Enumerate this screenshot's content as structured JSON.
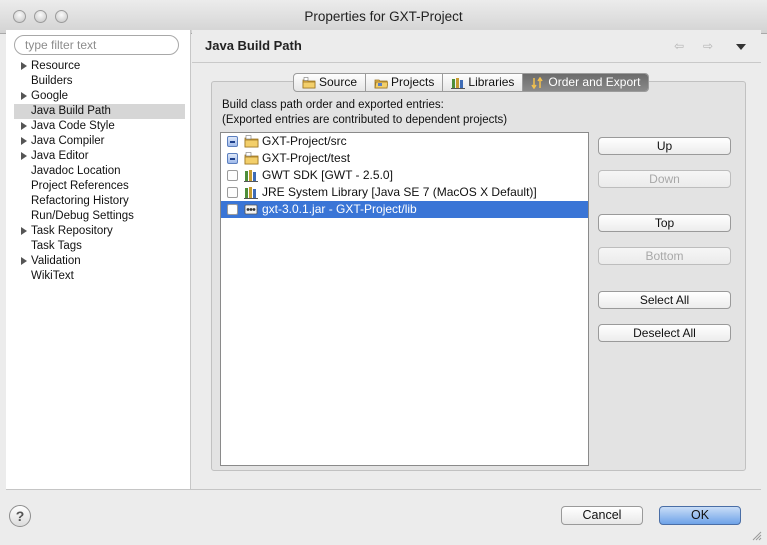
{
  "window": {
    "title": "Properties for GXT-Project"
  },
  "filter": {
    "placeholder": "type filter text"
  },
  "sidebar": {
    "items": [
      {
        "label": "Resource",
        "expandable": true
      },
      {
        "label": "Builders",
        "expandable": false
      },
      {
        "label": "Google",
        "expandable": true
      },
      {
        "label": "Java Build Path",
        "expandable": false,
        "selected": true
      },
      {
        "label": "Java Code Style",
        "expandable": true
      },
      {
        "label": "Java Compiler",
        "expandable": true
      },
      {
        "label": "Java Editor",
        "expandable": true
      },
      {
        "label": "Javadoc Location",
        "expandable": false
      },
      {
        "label": "Project References",
        "expandable": false
      },
      {
        "label": "Refactoring History",
        "expandable": false
      },
      {
        "label": "Run/Debug Settings",
        "expandable": false
      },
      {
        "label": "Task Repository",
        "expandable": true
      },
      {
        "label": "Task Tags",
        "expandable": false
      },
      {
        "label": "Validation",
        "expandable": true
      },
      {
        "label": "WikiText",
        "expandable": false
      }
    ]
  },
  "page": {
    "title": "Java Build Path",
    "back_glyph": "⇦",
    "forward_glyph": "⇨"
  },
  "tabs": [
    {
      "label": "Source",
      "icon": "source-folder-icon",
      "active": false
    },
    {
      "label": "Projects",
      "icon": "project-folder-icon",
      "active": false
    },
    {
      "label": "Libraries",
      "icon": "library-books-icon",
      "active": false
    },
    {
      "label": "Order and Export",
      "icon": "order-arrows-icon",
      "active": true
    }
  ],
  "description": {
    "line1": "Build class path order and exported entries:",
    "line2": "(Exported entries are contributed to dependent projects)"
  },
  "entries": [
    {
      "label": "GXT-Project/src",
      "icon": "source-folder-icon",
      "check": "mixed",
      "selected": false
    },
    {
      "label": "GXT-Project/test",
      "icon": "source-folder-icon",
      "check": "mixed",
      "selected": false
    },
    {
      "label": "GWT SDK [GWT - 2.5.0]",
      "icon": "library-books-icon",
      "check": "unchecked",
      "selected": false
    },
    {
      "label": "JRE System Library [Java SE 7 (MacOS X Default)]",
      "icon": "library-books-icon",
      "check": "unchecked",
      "selected": false
    },
    {
      "label": "gxt-3.0.1.jar - GXT-Project/lib",
      "icon": "jar-file-icon",
      "check": "unchecked",
      "selected": true
    }
  ],
  "buttons": {
    "up": "Up",
    "down": "Down",
    "top": "Top",
    "bottom": "Bottom",
    "select_all": "Select All",
    "deselect_all": "Deselect All"
  },
  "footer": {
    "help": "?",
    "cancel": "Cancel",
    "ok": "OK"
  },
  "colors": {
    "selection": "#3a75d6",
    "sidebar_selection": "#d6d6d6",
    "ok_button": "#6ea2e8"
  }
}
